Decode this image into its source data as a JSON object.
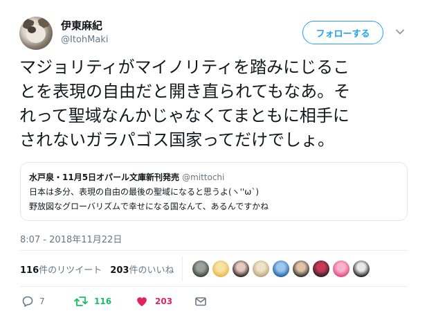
{
  "user": {
    "name": "伊東麻紀",
    "handle": "@ItohMaki"
  },
  "follow_button": {
    "label": "フォローする"
  },
  "tweet": {
    "lines": [
      "マジョリティがマイノリティを踏みにじるこ",
      "とを表現の自由だと開き直られてもなあ。そ",
      "れって聖域なんかじゃなくてまともに相手に",
      "されないガラパゴス国家ってだけでしょ。"
    ]
  },
  "quote": {
    "name": "水戸泉・11月5日オパール文庫新刊発売",
    "handle": "@mittochi",
    "lines": [
      "日本は多分、表現の自由の最後の聖域になると思うよ(ヽ''ω`)",
      "野放図なグローバリズムで幸せになる国なんて、あるんですかね"
    ]
  },
  "timestamp": "8:07 - 2018年11月22日",
  "stats": {
    "retweets_count": "116",
    "retweets_label": "件のリツイート",
    "likes_count": "203",
    "likes_label": "件のいいね"
  },
  "likers": [
    {
      "icon": "liker-avatar-1",
      "colors": [
        "#3a3f3a",
        "#9aa39c"
      ]
    },
    {
      "icon": "liker-avatar-2",
      "colors": [
        "#e8b64a",
        "#f7e3a3"
      ]
    },
    {
      "icon": "liker-avatar-3",
      "colors": [
        "#2a2020",
        "#e7c9c0"
      ]
    },
    {
      "icon": "liker-avatar-4",
      "colors": [
        "#b9a27a",
        "#efe3c9"
      ]
    },
    {
      "icon": "liker-avatar-5",
      "colors": [
        "#1f5fa8",
        "#9cc8ee"
      ]
    },
    {
      "icon": "liker-avatar-6",
      "colors": [
        "#2b2b2b",
        "#e2c4a8"
      ]
    },
    {
      "icon": "liker-avatar-7",
      "colors": [
        "#222222",
        "#c83a5a"
      ]
    },
    {
      "icon": "liker-avatar-8",
      "colors": [
        "#e0467c",
        "#f7b5cc"
      ]
    },
    {
      "icon": "liker-avatar-9",
      "colors": [
        "#1a1a1a",
        "#e9e9e9"
      ]
    }
  ],
  "actions": {
    "reply_count": "7",
    "retweet_count": "116",
    "like_count": "203"
  },
  "colors": {
    "accent": "#1da1f2",
    "retweet": "#17bf63",
    "like": "#e0245e",
    "muted": "#657786"
  }
}
